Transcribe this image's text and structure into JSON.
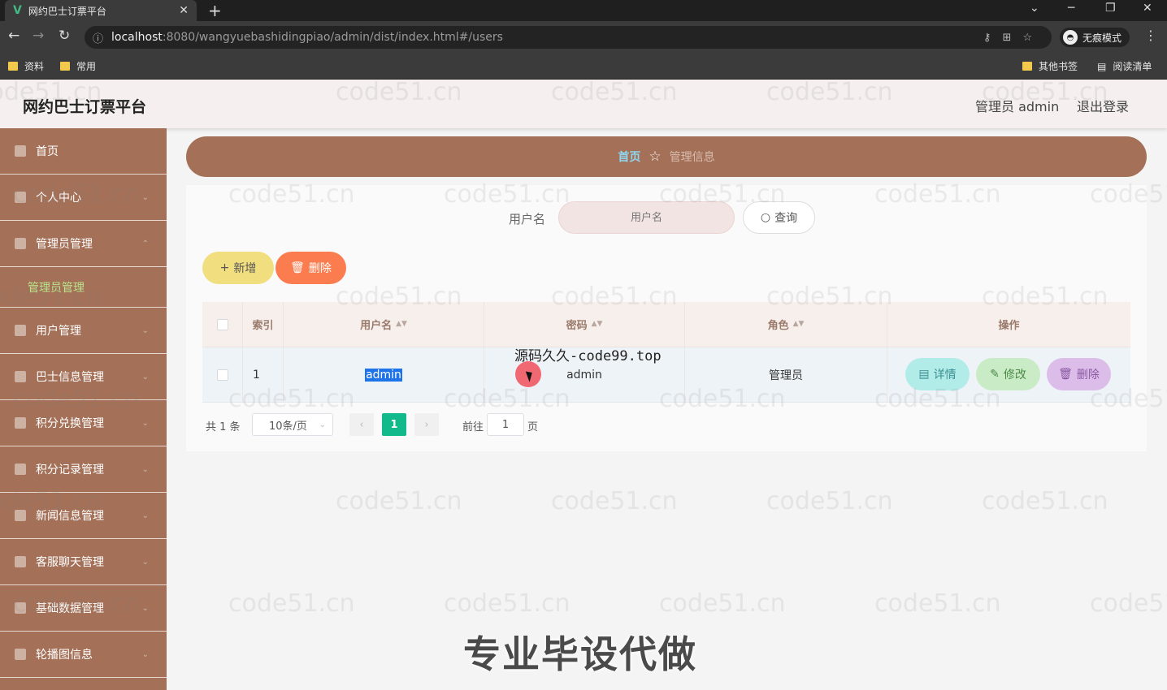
{
  "browser": {
    "tab_title": "网约巴士订票平台",
    "tab_icon": "vue-logo-icon",
    "url_host": "localhost",
    "url_path": ":8080/wangyuebashidingpiao/admin/dist/index.html#/users",
    "incognito_label": "无痕模式",
    "bookmarks": [
      "资料",
      "常用"
    ],
    "other_bookmarks": "其他书签",
    "reading_list": "阅读清单"
  },
  "header": {
    "title": "网约巴士订票平台",
    "admin_label": "管理员 admin",
    "logout_label": "退出登录"
  },
  "sidebar": {
    "items": [
      {
        "label": "首页",
        "icon": "home-icon"
      },
      {
        "label": "个人中心",
        "icon": "user-icon"
      },
      {
        "label": "管理员管理",
        "icon": "mail-icon"
      },
      {
        "label": "管理员管理",
        "icon": "",
        "sub": true
      },
      {
        "label": "用户管理",
        "icon": "document-icon"
      },
      {
        "label": "巴士信息管理",
        "icon": "checkbox-icon"
      },
      {
        "label": "积分兑换管理",
        "icon": "microphone-icon"
      },
      {
        "label": "积分记录管理",
        "icon": "grid-icon"
      },
      {
        "label": "新闻信息管理",
        "icon": "chart-icon"
      },
      {
        "label": "客服聊天管理",
        "icon": "edit-icon"
      },
      {
        "label": "基础数据管理",
        "icon": "table-icon"
      },
      {
        "label": "轮播图信息",
        "icon": "phone-icon"
      }
    ]
  },
  "breadcrumb": {
    "home": "首页",
    "current": "管理信息"
  },
  "search": {
    "label": "用户名",
    "placeholder": "用户名",
    "button": "查询"
  },
  "actions": {
    "add": "新增",
    "delete": "删除"
  },
  "table": {
    "columns": [
      "索引",
      "用户名",
      "密码",
      "角色",
      "操作"
    ],
    "rows": [
      {
        "index": "1",
        "username": "admin",
        "password": "admin",
        "role": "管理员"
      }
    ],
    "row_actions": {
      "detail": "详情",
      "edit": "修改",
      "remove": "删除"
    }
  },
  "pagination": {
    "total": "共 1 条",
    "page_size": "10条/页",
    "current": "1",
    "goto_label": "前往",
    "goto_value": "1",
    "page_suffix": "页"
  },
  "overlays": {
    "watermark": "code51.cn",
    "source_text": "源码久久-code99.top",
    "banner": "专业毕设代做"
  },
  "colors": {
    "sidebar": "#a47158",
    "header": "#f5efef",
    "add_button": "#f0de7f",
    "delete_button": "#fb7d4f",
    "pager_active": "#12b98a"
  }
}
